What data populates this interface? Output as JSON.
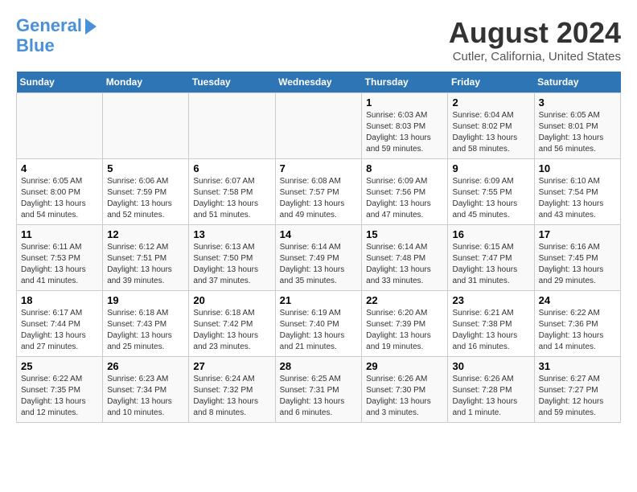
{
  "header": {
    "logo_line1": "General",
    "logo_line2": "Blue",
    "month_title": "August 2024",
    "location": "Cutler, California, United States"
  },
  "weekdays": [
    "Sunday",
    "Monday",
    "Tuesday",
    "Wednesday",
    "Thursday",
    "Friday",
    "Saturday"
  ],
  "weeks": [
    [
      {
        "day": "",
        "sunrise": "",
        "sunset": "",
        "daylight": ""
      },
      {
        "day": "",
        "sunrise": "",
        "sunset": "",
        "daylight": ""
      },
      {
        "day": "",
        "sunrise": "",
        "sunset": "",
        "daylight": ""
      },
      {
        "day": "",
        "sunrise": "",
        "sunset": "",
        "daylight": ""
      },
      {
        "day": "1",
        "sunrise": "Sunrise: 6:03 AM",
        "sunset": "Sunset: 8:03 PM",
        "daylight": "Daylight: 13 hours and 59 minutes."
      },
      {
        "day": "2",
        "sunrise": "Sunrise: 6:04 AM",
        "sunset": "Sunset: 8:02 PM",
        "daylight": "Daylight: 13 hours and 58 minutes."
      },
      {
        "day": "3",
        "sunrise": "Sunrise: 6:05 AM",
        "sunset": "Sunset: 8:01 PM",
        "daylight": "Daylight: 13 hours and 56 minutes."
      }
    ],
    [
      {
        "day": "4",
        "sunrise": "Sunrise: 6:05 AM",
        "sunset": "Sunset: 8:00 PM",
        "daylight": "Daylight: 13 hours and 54 minutes."
      },
      {
        "day": "5",
        "sunrise": "Sunrise: 6:06 AM",
        "sunset": "Sunset: 7:59 PM",
        "daylight": "Daylight: 13 hours and 52 minutes."
      },
      {
        "day": "6",
        "sunrise": "Sunrise: 6:07 AM",
        "sunset": "Sunset: 7:58 PM",
        "daylight": "Daylight: 13 hours and 51 minutes."
      },
      {
        "day": "7",
        "sunrise": "Sunrise: 6:08 AM",
        "sunset": "Sunset: 7:57 PM",
        "daylight": "Daylight: 13 hours and 49 minutes."
      },
      {
        "day": "8",
        "sunrise": "Sunrise: 6:09 AM",
        "sunset": "Sunset: 7:56 PM",
        "daylight": "Daylight: 13 hours and 47 minutes."
      },
      {
        "day": "9",
        "sunrise": "Sunrise: 6:09 AM",
        "sunset": "Sunset: 7:55 PM",
        "daylight": "Daylight: 13 hours and 45 minutes."
      },
      {
        "day": "10",
        "sunrise": "Sunrise: 6:10 AM",
        "sunset": "Sunset: 7:54 PM",
        "daylight": "Daylight: 13 hours and 43 minutes."
      }
    ],
    [
      {
        "day": "11",
        "sunrise": "Sunrise: 6:11 AM",
        "sunset": "Sunset: 7:53 PM",
        "daylight": "Daylight: 13 hours and 41 minutes."
      },
      {
        "day": "12",
        "sunrise": "Sunrise: 6:12 AM",
        "sunset": "Sunset: 7:51 PM",
        "daylight": "Daylight: 13 hours and 39 minutes."
      },
      {
        "day": "13",
        "sunrise": "Sunrise: 6:13 AM",
        "sunset": "Sunset: 7:50 PM",
        "daylight": "Daylight: 13 hours and 37 minutes."
      },
      {
        "day": "14",
        "sunrise": "Sunrise: 6:14 AM",
        "sunset": "Sunset: 7:49 PM",
        "daylight": "Daylight: 13 hours and 35 minutes."
      },
      {
        "day": "15",
        "sunrise": "Sunrise: 6:14 AM",
        "sunset": "Sunset: 7:48 PM",
        "daylight": "Daylight: 13 hours and 33 minutes."
      },
      {
        "day": "16",
        "sunrise": "Sunrise: 6:15 AM",
        "sunset": "Sunset: 7:47 PM",
        "daylight": "Daylight: 13 hours and 31 minutes."
      },
      {
        "day": "17",
        "sunrise": "Sunrise: 6:16 AM",
        "sunset": "Sunset: 7:45 PM",
        "daylight": "Daylight: 13 hours and 29 minutes."
      }
    ],
    [
      {
        "day": "18",
        "sunrise": "Sunrise: 6:17 AM",
        "sunset": "Sunset: 7:44 PM",
        "daylight": "Daylight: 13 hours and 27 minutes."
      },
      {
        "day": "19",
        "sunrise": "Sunrise: 6:18 AM",
        "sunset": "Sunset: 7:43 PM",
        "daylight": "Daylight: 13 hours and 25 minutes."
      },
      {
        "day": "20",
        "sunrise": "Sunrise: 6:18 AM",
        "sunset": "Sunset: 7:42 PM",
        "daylight": "Daylight: 13 hours and 23 minutes."
      },
      {
        "day": "21",
        "sunrise": "Sunrise: 6:19 AM",
        "sunset": "Sunset: 7:40 PM",
        "daylight": "Daylight: 13 hours and 21 minutes."
      },
      {
        "day": "22",
        "sunrise": "Sunrise: 6:20 AM",
        "sunset": "Sunset: 7:39 PM",
        "daylight": "Daylight: 13 hours and 19 minutes."
      },
      {
        "day": "23",
        "sunrise": "Sunrise: 6:21 AM",
        "sunset": "Sunset: 7:38 PM",
        "daylight": "Daylight: 13 hours and 16 minutes."
      },
      {
        "day": "24",
        "sunrise": "Sunrise: 6:22 AM",
        "sunset": "Sunset: 7:36 PM",
        "daylight": "Daylight: 13 hours and 14 minutes."
      }
    ],
    [
      {
        "day": "25",
        "sunrise": "Sunrise: 6:22 AM",
        "sunset": "Sunset: 7:35 PM",
        "daylight": "Daylight: 13 hours and 12 minutes."
      },
      {
        "day": "26",
        "sunrise": "Sunrise: 6:23 AM",
        "sunset": "Sunset: 7:34 PM",
        "daylight": "Daylight: 13 hours and 10 minutes."
      },
      {
        "day": "27",
        "sunrise": "Sunrise: 6:24 AM",
        "sunset": "Sunset: 7:32 PM",
        "daylight": "Daylight: 13 hours and 8 minutes."
      },
      {
        "day": "28",
        "sunrise": "Sunrise: 6:25 AM",
        "sunset": "Sunset: 7:31 PM",
        "daylight": "Daylight: 13 hours and 6 minutes."
      },
      {
        "day": "29",
        "sunrise": "Sunrise: 6:26 AM",
        "sunset": "Sunset: 7:30 PM",
        "daylight": "Daylight: 13 hours and 3 minutes."
      },
      {
        "day": "30",
        "sunrise": "Sunrise: 6:26 AM",
        "sunset": "Sunset: 7:28 PM",
        "daylight": "Daylight: 13 hours and 1 minute."
      },
      {
        "day": "31",
        "sunrise": "Sunrise: 6:27 AM",
        "sunset": "Sunset: 7:27 PM",
        "daylight": "Daylight: 12 hours and 59 minutes."
      }
    ]
  ]
}
